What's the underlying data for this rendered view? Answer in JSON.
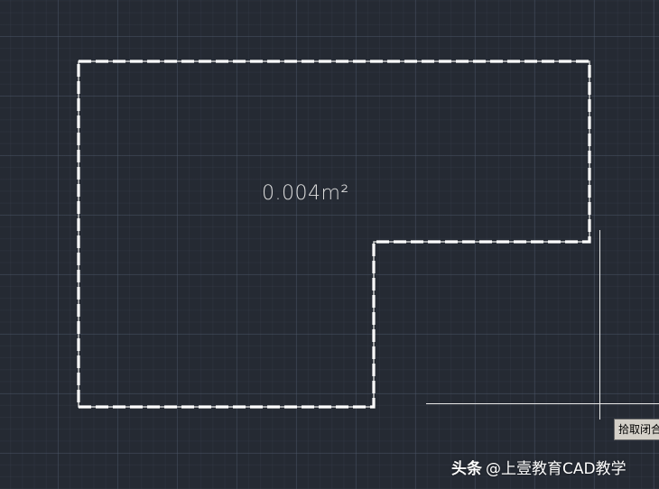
{
  "drawing": {
    "area_label": "0.004m²",
    "boundary_color": "#ffffff"
  },
  "cursor": {
    "tooltip_text": "拾取闭合"
  },
  "watermark": {
    "brand": "头条",
    "author": "@上壹教育CAD教学"
  }
}
